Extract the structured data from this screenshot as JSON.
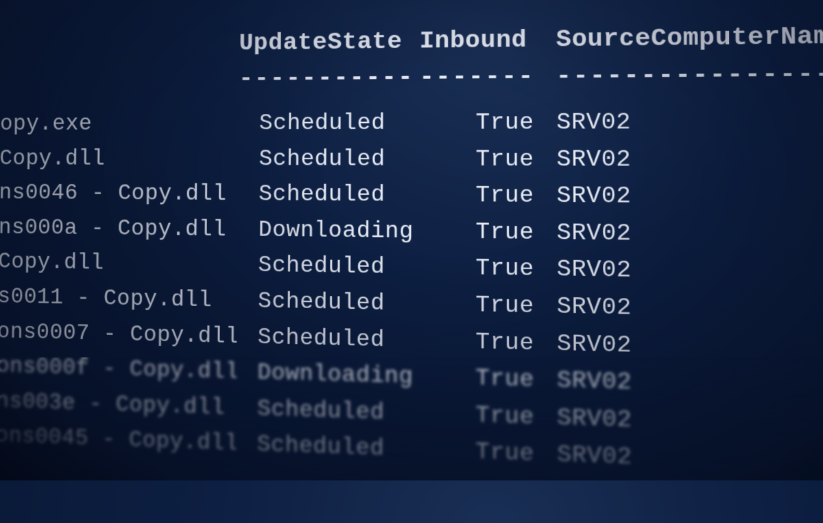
{
  "headers": {
    "state": "UpdateState",
    "inbound": "Inbound",
    "source": "SourceComputerName"
  },
  "dividers": {
    "state": "-----------",
    "inbound": "-------",
    "source": "------------------"
  },
  "rows": [
    {
      "file": "opy.exe",
      "state": "Scheduled",
      "inbound": "True",
      "source": "SRV02"
    },
    {
      "file": "Copy.dll",
      "state": "Scheduled",
      "inbound": "True",
      "source": "SRV02"
    },
    {
      "file": "ns0046 - Copy.dll",
      "state": "Scheduled",
      "inbound": "True",
      "source": "SRV02"
    },
    {
      "file": "ns000a - Copy.dll",
      "state": "Downloading",
      "inbound": "True",
      "source": "SRV02"
    },
    {
      "file": " Copy.dll",
      "state": "Scheduled",
      "inbound": "True",
      "source": "SRV02"
    },
    {
      "file": "s0011 - Copy.dll",
      "state": "Scheduled",
      "inbound": "True",
      "source": "SRV02"
    },
    {
      "file": "ons0007 - Copy.dll",
      "state": "Scheduled",
      "inbound": "True",
      "source": "SRV02"
    },
    {
      "file": "ons000f - Copy.dll",
      "state": "Downloading",
      "inbound": "True",
      "source": "SRV02"
    },
    {
      "file": "ns003e - Copy.dll",
      "state": "Scheduled",
      "inbound": "True",
      "source": "SRV02"
    },
    {
      "file": "ons0045 - Copy.dll",
      "state": "Scheduled",
      "inbound": "True",
      "source": "SRV02"
    }
  ]
}
